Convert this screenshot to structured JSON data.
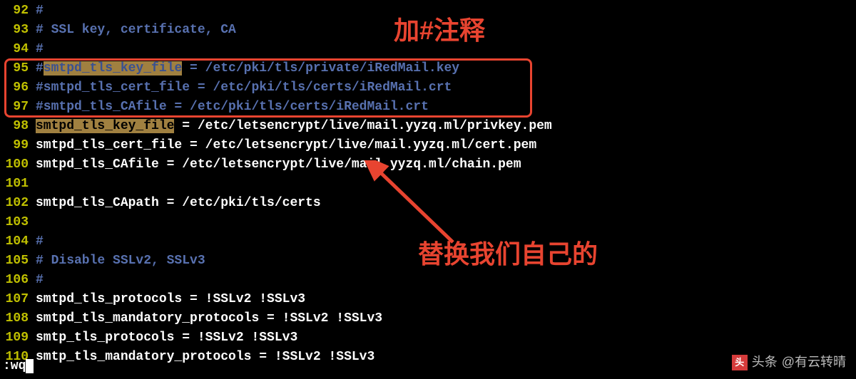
{
  "lines": [
    {
      "num": "92",
      "segments": [
        {
          "cls": "comment",
          "text": "#"
        }
      ]
    },
    {
      "num": "93",
      "segments": [
        {
          "cls": "comment",
          "text": "# SSL key, certificate, CA"
        }
      ]
    },
    {
      "num": "94",
      "segments": [
        {
          "cls": "comment",
          "text": "#"
        }
      ]
    },
    {
      "num": "95",
      "segments": [
        {
          "cls": "comment",
          "text": "#"
        },
        {
          "cls": "highlight-comment",
          "text": "smtpd_tls_key_file"
        },
        {
          "cls": "comment",
          "text": " = /etc/pki/tls/private/iRedMail.key"
        }
      ]
    },
    {
      "num": "96",
      "segments": [
        {
          "cls": "comment",
          "text": "#smtpd_tls_cert_file = /etc/pki/tls/certs/iRedMail.crt"
        }
      ]
    },
    {
      "num": "97",
      "segments": [
        {
          "cls": "comment",
          "text": "#smtpd_tls_CAfile = /etc/pki/tls/certs/iRedMail.crt"
        }
      ]
    },
    {
      "num": "98",
      "segments": [
        {
          "cls": "highlight",
          "text": "smtpd_tls_key_file"
        },
        {
          "cls": "white",
          "text": " = /etc/letsencrypt/live/mail.yyzq.ml/privkey.pem"
        }
      ]
    },
    {
      "num": "99",
      "segments": [
        {
          "cls": "white",
          "text": "smtpd_tls_cert_file = /etc/letsencrypt/live/mail.yyzq.ml/cert.pem"
        }
      ]
    },
    {
      "num": "100",
      "segments": [
        {
          "cls": "white",
          "text": "smtpd_tls_CAfile = /etc/letsencrypt/live/mail.yyzq.ml/chain.pem"
        }
      ]
    },
    {
      "num": "101",
      "segments": []
    },
    {
      "num": "102",
      "segments": [
        {
          "cls": "white",
          "text": "smtpd_tls_CApath = /etc/pki/tls/certs"
        }
      ]
    },
    {
      "num": "103",
      "segments": []
    },
    {
      "num": "104",
      "segments": [
        {
          "cls": "comment",
          "text": "#"
        }
      ]
    },
    {
      "num": "105",
      "segments": [
        {
          "cls": "comment",
          "text": "# Disable SSLv2, SSLv3"
        }
      ]
    },
    {
      "num": "106",
      "segments": [
        {
          "cls": "comment",
          "text": "#"
        }
      ]
    },
    {
      "num": "107",
      "segments": [
        {
          "cls": "white",
          "text": "smtpd_tls_protocols = !SSLv2 !SSLv3"
        }
      ]
    },
    {
      "num": "108",
      "segments": [
        {
          "cls": "white",
          "text": "smtpd_tls_mandatory_protocols = !SSLv2 !SSLv3"
        }
      ]
    },
    {
      "num": "109",
      "segments": [
        {
          "cls": "white",
          "text": "smtp_tls_protocols = !SSLv2 !SSLv3"
        }
      ]
    },
    {
      "num": "110",
      "segments": [
        {
          "cls": "white",
          "text": "smtp_tls_mandatory_protocols = !SSLv2 !SSLv3"
        }
      ]
    }
  ],
  "annotations": {
    "top": "加#注释",
    "bottom": "替换我们自己的"
  },
  "status": ":wq",
  "watermark": {
    "logo_text": "头",
    "label": "头条",
    "user": "@有云转晴"
  }
}
